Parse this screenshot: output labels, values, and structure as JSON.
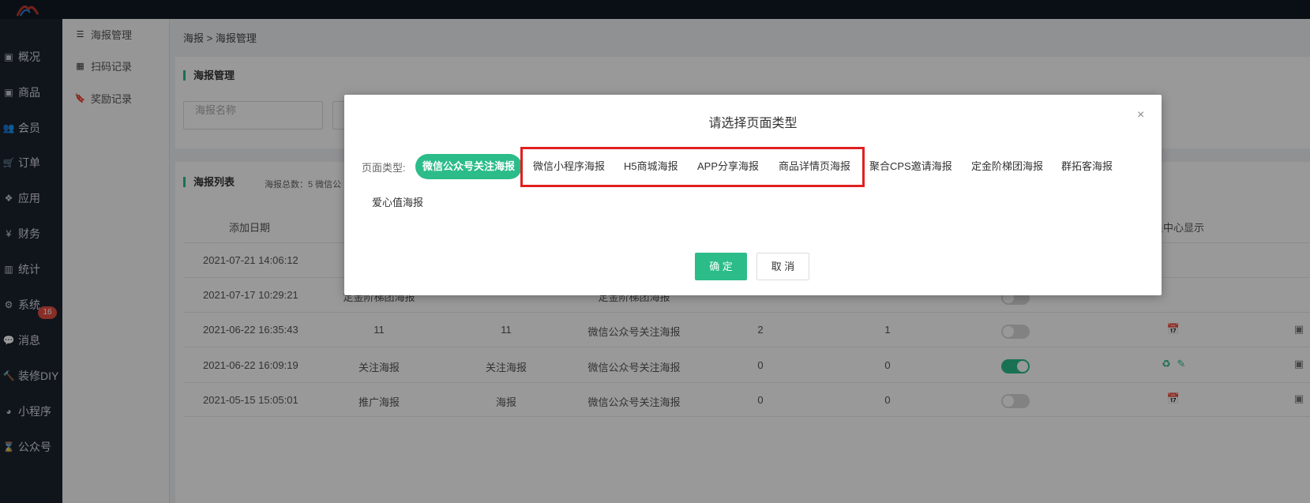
{
  "leftnav": [
    {
      "label": "概况",
      "icon": "archive-icon"
    },
    {
      "label": "商品",
      "icon": "archive-icon"
    },
    {
      "label": "会员",
      "icon": "users-icon"
    },
    {
      "label": "订单",
      "icon": "cart-icon"
    },
    {
      "label": "应用",
      "icon": "apps-icon"
    },
    {
      "label": "财务",
      "icon": "yen-icon"
    },
    {
      "label": "统计",
      "icon": "bar-chart-icon"
    },
    {
      "label": "系统",
      "icon": "gears-icon"
    },
    {
      "label": "消息",
      "icon": "comment-icon"
    },
    {
      "label": "装修DIY",
      "icon": "gavel-icon"
    },
    {
      "label": "小程序",
      "icon": "wechat-icon"
    },
    {
      "label": "公众号",
      "icon": "hourglass-icon"
    }
  ],
  "message_badge": "16",
  "subnav": [
    {
      "label": "海报管理",
      "icon": "list-icon"
    },
    {
      "label": "扫码记录",
      "icon": "qrcode-icon"
    },
    {
      "label": "奖励记录",
      "icon": "bookmark-icon"
    }
  ],
  "breadcrumb": "海报 > 海报管理",
  "filter_card": {
    "title": "海报管理",
    "search_placeholder": "海报名称"
  },
  "list_card": {
    "title": "海报列表",
    "stats": "海报总数：5    微信公"
  },
  "table": {
    "headers": {
      "date": "添加日期",
      "center": "员中心显示"
    },
    "rows": [
      {
        "date": "2021-07-21 14:06:12",
        "name": "",
        "title": "",
        "type": "",
        "scans": "",
        "fans": "",
        "toggle": false,
        "toggle_visible": false
      },
      {
        "date": "2021-07-17 10:29:21",
        "name": "定金阶梯团海报",
        "title": "",
        "type": "定金阶梯团海报",
        "scans": "",
        "fans": "",
        "toggle": false,
        "toggle_visible": true
      },
      {
        "date": "2021-06-22 16:35:43",
        "name": "11",
        "title": "11",
        "type": "微信公众号关注海报",
        "scans": "2",
        "fans": "1",
        "toggle": false,
        "toggle_visible": true
      },
      {
        "date": "2021-06-22 16:09:19",
        "name": "关注海报",
        "title": "关注海报",
        "type": "微信公众号关注海报",
        "scans": "0",
        "fans": "0",
        "toggle": true,
        "toggle_visible": true
      },
      {
        "date": "2021-05-15 15:05:01",
        "name": "推广海报",
        "title": "海报",
        "type": "微信公众号关注海报",
        "scans": "0",
        "fans": "0",
        "toggle": false,
        "toggle_visible": true
      }
    ]
  },
  "modal": {
    "title": "请选择页面类型",
    "close": "×",
    "type_label": "页面类型:",
    "types": [
      "微信公众号关注海报",
      "微信小程序海报",
      "H5商城海报",
      "APP分享海报",
      "商品详情页海报",
      "聚合CPS邀请海报",
      "定金阶梯团海报",
      "群拓客海报",
      "爱心值海报"
    ],
    "selected": "微信公众号关注海报",
    "confirm": "确 定",
    "cancel": "取 消"
  },
  "colors": {
    "accent": "#2bbc8a",
    "highlight": "#e02020",
    "nav_bg": "#1c2330"
  }
}
